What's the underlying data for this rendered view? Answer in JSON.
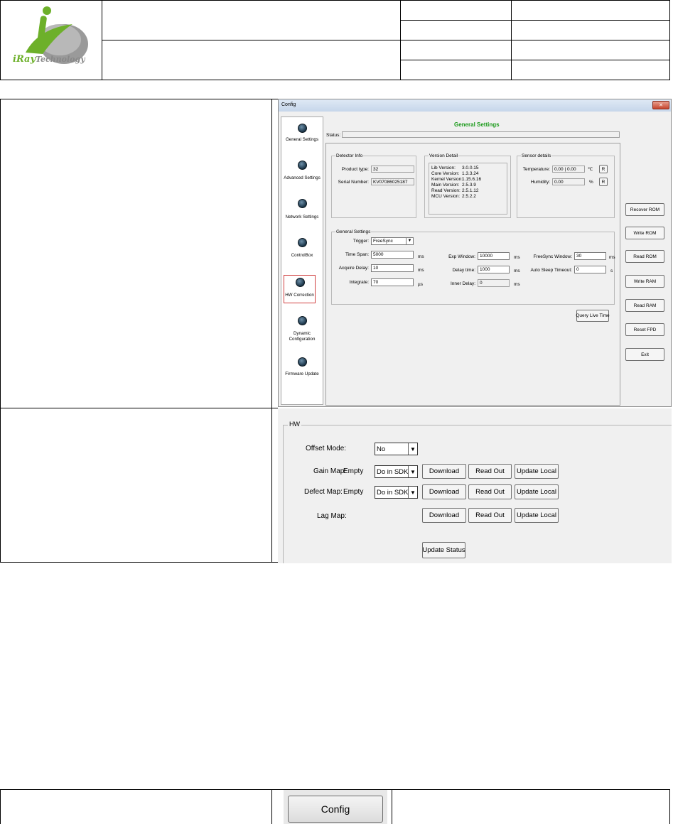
{
  "logo": {
    "text_a": "i",
    "text_b": "Ray",
    "text_c": "Technology"
  },
  "config_window": {
    "title": "Config",
    "close_glyph": "✕",
    "heading": "General Settings",
    "status_label": "Status:",
    "nav": [
      {
        "label": "General Settings"
      },
      {
        "label": "Advanced Settings"
      },
      {
        "label": "Network Settings"
      },
      {
        "label": "ControlBox"
      },
      {
        "label": "HW Correction"
      },
      {
        "label": "Dynamic Configuration"
      },
      {
        "label": "Firmware Update"
      }
    ],
    "detector_info": {
      "title": "Detector Info",
      "product_type_label": "Product type:",
      "product_type": "32",
      "serial_label": "Serial Number:",
      "serial": "KV07086025187"
    },
    "version_detail": {
      "title": "Version Detail",
      "rows": [
        {
          "k": "Lib Version:",
          "v": "3.0.0.15"
        },
        {
          "k": "Core Version:",
          "v": "1.3.3.24"
        },
        {
          "k": "Kernel Version:",
          "v": "1.15.6.16"
        },
        {
          "k": "Main Version:",
          "v": "2.5.3.9"
        },
        {
          "k": "Read Version:",
          "v": "2.5.1.12"
        },
        {
          "k": "MCU Version:",
          "v": "2.5.2.2"
        }
      ]
    },
    "sensor_details": {
      "title": "Sensor details",
      "temp_label": "Temperature:",
      "temp_value": "0.00 | 0.00",
      "temp_unit": "℃",
      "humidity_label": "Humidity:",
      "humidity_value": "0.00",
      "humidity_unit": "%",
      "refresh_label": "R"
    },
    "general": {
      "title": "General Settings",
      "trigger_label": "Trigger:",
      "trigger": "FreeSync",
      "time_span_label": "Time Span:",
      "time_span": "5000",
      "acquire_delay_label": "Acquire Delay:",
      "acquire_delay": "10",
      "integrate_label": "Integrate:",
      "integrate": "70",
      "exp_window_label": "Exp Window:",
      "exp_window": "10000",
      "delay_time_label": "Delay time:",
      "delay_time": "1000",
      "inner_delay_label": "Inner Delay:",
      "inner_delay": "0",
      "freesync_label": "FreeSync Window:",
      "freesync": "30",
      "auto_sleep_label": "Auto Sleep Timeout:",
      "auto_sleep": "0",
      "unit_ms": "ms",
      "unit_us": "µs",
      "unit_s": "s"
    },
    "query_live_time": "Query Live Time",
    "side_buttons": [
      "Recover ROM",
      "Write ROM",
      "Read ROM",
      "Write RAM",
      "Read RAM",
      "Reset FPD",
      "Exit"
    ]
  },
  "hw_panel": {
    "title": "HW",
    "offset_label": "Offset Mode:",
    "offset_value": "No",
    "gain_label": "Gain Map:",
    "gain_state": "Empty",
    "gain_value": "Do in SDK",
    "defect_label": "Defect Map:",
    "defect_state": "Empty",
    "defect_value": "Do in SDK",
    "log_label": "Lag Map:",
    "download": "Download",
    "read_out": "Read Out",
    "update_local": "Update Local",
    "update_status": "Update  Status"
  },
  "bottom_button": {
    "label": "Config"
  }
}
